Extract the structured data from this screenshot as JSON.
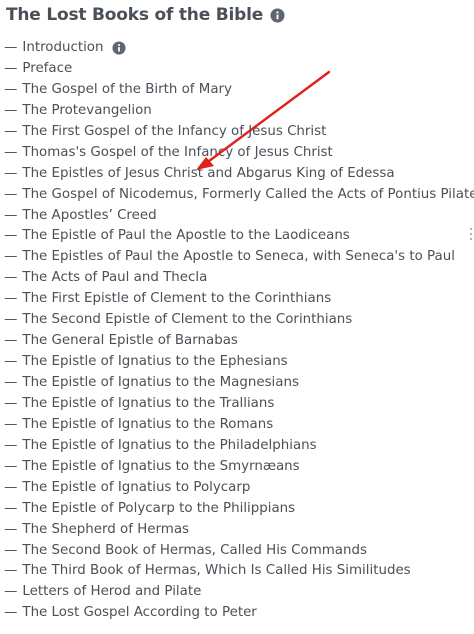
{
  "header": {
    "title": "The Lost Books of the Bible",
    "info_icon": "info-circle-icon"
  },
  "toc": {
    "dash": "—",
    "items": [
      {
        "label": "Introduction",
        "has_info": true
      },
      {
        "label": "Preface"
      },
      {
        "label": "The Gospel of the Birth of Mary"
      },
      {
        "label": "The Protevangelion"
      },
      {
        "label": "The First Gospel of the Infancy of Jesus Christ"
      },
      {
        "label": "Thomas's Gospel of the Infancy of Jesus Christ"
      },
      {
        "label": "The Epistles of Jesus Christ and Abgarus King of Edessa"
      },
      {
        "label": "The Gospel of Nicodemus, Formerly Called the Acts of Pontius Pilate"
      },
      {
        "label": "The Apostles’ Creed"
      },
      {
        "label": "The Epistle of Paul the Apostle to the Laodiceans"
      },
      {
        "label": "The Epistles of Paul the Apostle to Seneca, with Seneca's to Paul"
      },
      {
        "label": "The Acts of Paul and Thecla"
      },
      {
        "label": "The First Epistle of Clement to the Corinthians"
      },
      {
        "label": "The Second Epistle of Clement to the Corinthians"
      },
      {
        "label": "The General Epistle of Barnabas"
      },
      {
        "label": "The Epistle of Ignatius to the Ephesians"
      },
      {
        "label": "The Epistle of Ignatius to the Magnesians"
      },
      {
        "label": "The Epistle of Ignatius to the Trallians"
      },
      {
        "label": "The Epistle of Ignatius to the Romans"
      },
      {
        "label": "The Epistle of Ignatius to the Philadelphians"
      },
      {
        "label": "The Epistle of Ignatius to the Smyrnæans"
      },
      {
        "label": "The Epistle of Ignatius to Polycarp"
      },
      {
        "label": "The Epistle of Polycarp to the Philippians"
      },
      {
        "label": "The Shepherd of Hermas"
      },
      {
        "label": "The Second Book of Hermas, Called His Commands"
      },
      {
        "label": "The Third Book of Hermas, Which Is Called His Similitudes"
      },
      {
        "label": "Letters of Herod and Pilate"
      },
      {
        "label": "The Lost Gospel According to Peter"
      }
    ]
  },
  "annotation": {
    "arrow_color": "#e0201b",
    "points_to": "The Epistles of Jesus Christ and Abgarus King of Edessa"
  }
}
